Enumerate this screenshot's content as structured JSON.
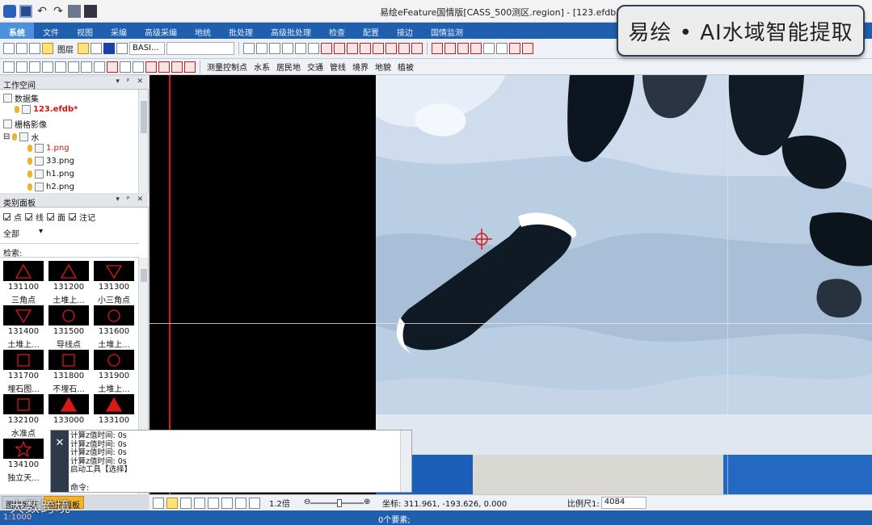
{
  "window": {
    "title": "易绘eFeature国情版[CASS_500测区.region] - [123.efdb]"
  },
  "banner": {
    "text": "易绘 • AI水域智能提取"
  },
  "menu": {
    "items": [
      "系统",
      "文件",
      "视图",
      "采编",
      "高级采编",
      "地统",
      "批处理",
      "高级批处理",
      "检查",
      "配置",
      "接边",
      "国情监测"
    ],
    "active": "系统"
  },
  "toolbar": {
    "layer_label": "图层",
    "style_select": "BASI...",
    "layer_select": "",
    "categories": [
      "测量控制点",
      "水系",
      "居民地",
      "交通",
      "管线",
      "境界",
      "地貌",
      "植被"
    ]
  },
  "workspace": {
    "title": "工作空间",
    "dataset_label": "数据集",
    "db_file": "123.efdb*",
    "raster_label": "栅格影像",
    "water_group": "水",
    "files": [
      "1.png",
      "33.png",
      "h1.png",
      "h2.png"
    ]
  },
  "category_panel": {
    "title": "类别面板",
    "filters": [
      "点",
      "线",
      "面",
      "注记"
    ],
    "scope": "全部",
    "search_label": "检索:",
    "symbols": [
      {
        "code": "131100",
        "name": "三角点"
      },
      {
        "code": "131200",
        "name": "土堆上..."
      },
      {
        "code": "131300",
        "name": "小三角点"
      },
      {
        "code": "131400",
        "name": "土堆上..."
      },
      {
        "code": "131500",
        "name": "导线点"
      },
      {
        "code": "131600",
        "name": "土堆上..."
      },
      {
        "code": "131700",
        "name": "埋石图..."
      },
      {
        "code": "131800",
        "name": "不埋石..."
      },
      {
        "code": "131900",
        "name": "土堆上..."
      },
      {
        "code": "132100",
        "name": "水准点"
      },
      {
        "code": "133000",
        "name": ""
      },
      {
        "code": "133100",
        "name": ""
      },
      {
        "code": "134100",
        "name": "独立天..."
      }
    ]
  },
  "command": {
    "lines": [
      "计算z值时间: 0s",
      "计算z值时间: 0s",
      "计算z值时间: 0s",
      "计算z值时间: 0s",
      "启动工具【选择】"
    ],
    "prompt": "命令:"
  },
  "bottom_tabs": [
    "图层列表",
    "类别面板"
  ],
  "status": {
    "zoom": "1.2倍",
    "coords": "坐标: 311.961, -193.626, 0.000",
    "scale_label": "比例尺1:",
    "scale_value": "4084",
    "elements": "0个要素;",
    "left_status": "1:1000",
    "slider_fraction": 0.55
  },
  "watermark": "大数跨境"
}
